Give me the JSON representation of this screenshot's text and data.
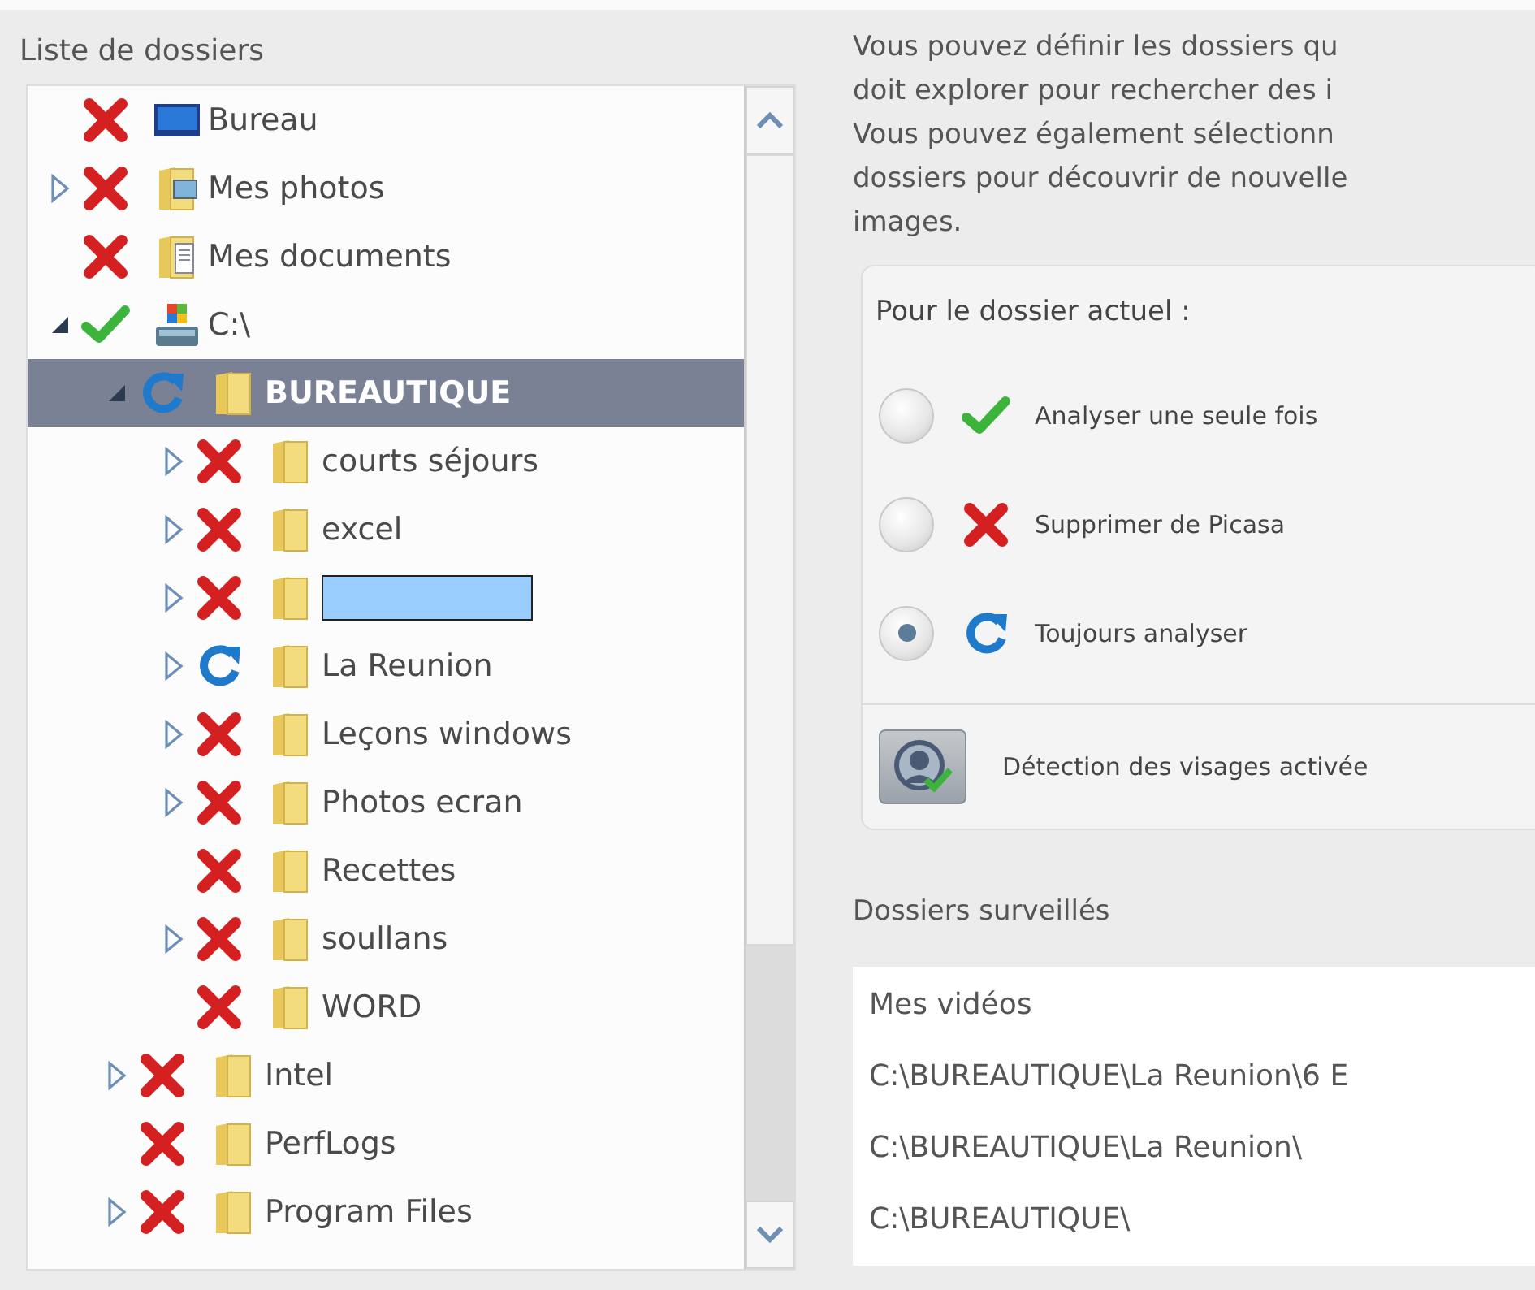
{
  "folder_list": {
    "title": "Liste de dossiers",
    "items": [
      {
        "label": "Bureau",
        "icon": {
          "kind": "desktop"
        },
        "kind": "excluded",
        "selected": false
      },
      {
        "label": "Mes photos",
        "icon": {
          "kind": "pictures"
        },
        "kind": "excluded",
        "selected": false,
        "expanded": false
      },
      {
        "label": "Mes documents",
        "icon": {
          "kind": "documents"
        },
        "kind": "excluded",
        "selected": false
      },
      {
        "label": "C:\\",
        "icon": {
          "kind": "drive"
        },
        "kind": "once",
        "selected": false,
        "expanded": true,
        "children": [
          {
            "label": "BUREAUTIQUE",
            "icon": {
              "kind": "folder"
            },
            "kind": "always",
            "selected": true,
            "expanded": true,
            "children": [
              {
                "label": "courts séjours",
                "icon": {
                  "kind": "folder"
                },
                "kind": "excluded",
                "selected": false,
                "expanded": false
              },
              {
                "label": "excel",
                "icon": {
                  "kind": "folder"
                },
                "kind": "excluded",
                "selected": false,
                "expanded": false
              },
              {
                "icon": {
                  "kind": "folder"
                },
                "kind": "excluded",
                "selected": false,
                "expanded": false
              },
              {
                "label": "La Reunion",
                "icon": {
                  "kind": "folder"
                },
                "kind": "always",
                "selected": false,
                "expanded": false
              },
              {
                "label": "Leçons windows",
                "icon": {
                  "kind": "folder"
                },
                "kind": "excluded",
                "selected": false,
                "expanded": false
              },
              {
                "label": "Photos ecran",
                "icon": {
                  "kind": "folder"
                },
                "kind": "excluded",
                "selected": false,
                "expanded": false
              },
              {
                "label": "Recettes",
                "icon": {
                  "kind": "folder"
                },
                "kind": "excluded",
                "selected": false
              },
              {
                "label": "soullans",
                "icon": {
                  "kind": "folder"
                },
                "kind": "excluded",
                "selected": false,
                "expanded": false
              },
              {
                "label": "WORD",
                "icon": {
                  "kind": "folder"
                },
                "kind": "excluded",
                "selected": false
              }
            ]
          },
          {
            "label": "Intel",
            "icon": {
              "kind": "folder"
            },
            "kind": "excluded",
            "selected": false,
            "expanded": false
          },
          {
            "label": "PerfLogs",
            "icon": {
              "kind": "folder"
            },
            "kind": "excluded",
            "selected": false
          },
          {
            "label": "Program Files",
            "icon": {
              "kind": "folder"
            },
            "kind": "excluded",
            "selected": false,
            "expanded": false
          }
        ]
      }
    ]
  },
  "description": {
    "lines": [
      "Vous pouvez définir les dossiers qu",
      "doit explorer pour rechercher des i",
      "Vous pouvez également sélectionn",
      "dossiers pour découvrir de nouvelle",
      "images."
    ]
  },
  "current_folder": {
    "title": "Pour le dossier actuel :",
    "options": [
      {
        "kind": "once",
        "label": "Analyser une seule fois",
        "selected": false
      },
      {
        "kind": "excluded",
        "label": "Supprimer de Picasa",
        "selected": false
      },
      {
        "kind": "always",
        "label": "Toujours analyser",
        "selected": true
      }
    ],
    "face_detection": {
      "label": "Détection des visages activée",
      "on": true
    }
  },
  "watched_folders": {
    "title": "Dossiers surveillés",
    "items": [
      "Mes vidéos",
      "C:\\BUREAUTIQUE\\La Reunion\\6 E",
      "C:\\BUREAUTIQUE\\La Reunion\\",
      "C:\\BUREAUTIQUE\\"
    ]
  }
}
